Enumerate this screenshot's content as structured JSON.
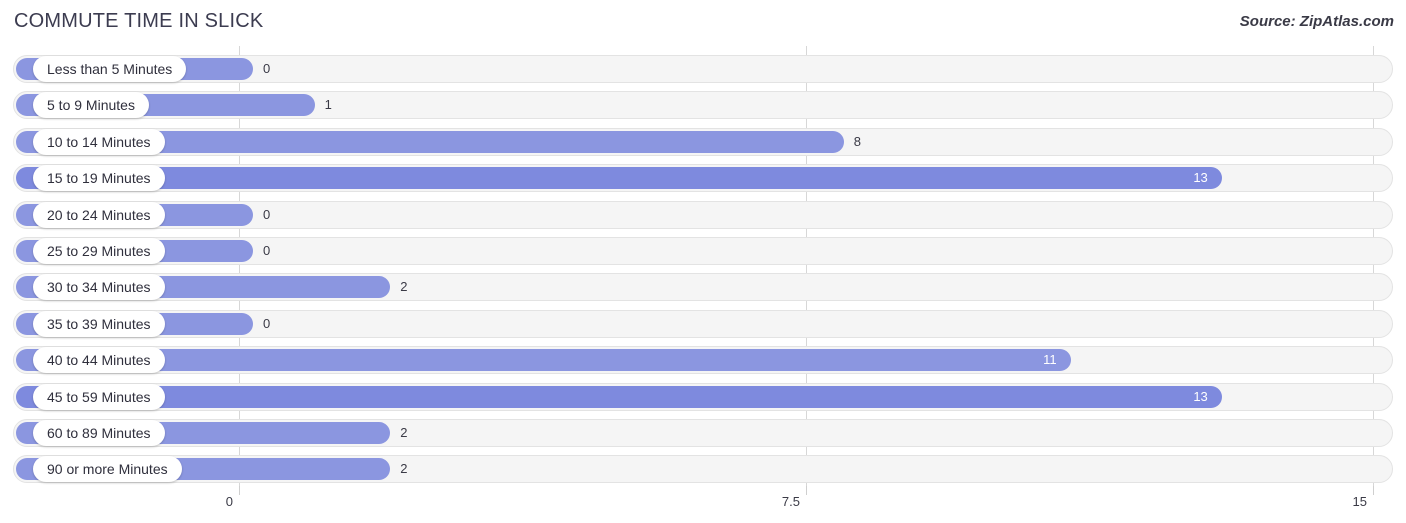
{
  "header": {
    "title": "COMMUTE TIME IN SLICK",
    "source": "Source: ZipAtlas.com"
  },
  "colors": {
    "bar": "#8b96e0",
    "bar_deep": "#7e8ade",
    "track": "#f5f5f5",
    "gridline": "#d7d7d7",
    "title_text": "#3c3c50",
    "value_text_inside": "#ffffff",
    "value_text_outside": "#3a3a46"
  },
  "chart_data": {
    "type": "bar",
    "orientation": "horizontal",
    "title": "COMMUTE TIME IN SLICK",
    "xlabel": "",
    "ylabel": "",
    "xlim": [
      0,
      15
    ],
    "grid": true,
    "legend": "none",
    "xticks": [
      "0",
      "7.5",
      "15"
    ],
    "xtick_values": [
      0,
      7.5,
      15
    ],
    "categories": [
      "Less than 5 Minutes",
      "5 to 9 Minutes",
      "10 to 14 Minutes",
      "15 to 19 Minutes",
      "20 to 24 Minutes",
      "25 to 29 Minutes",
      "30 to 34 Minutes",
      "35 to 39 Minutes",
      "40 to 44 Minutes",
      "45 to 59 Minutes",
      "60 to 89 Minutes",
      "90 or more Minutes"
    ],
    "values": [
      0,
      1,
      8,
      13,
      0,
      0,
      2,
      0,
      11,
      13,
      2,
      2
    ],
    "value_labels": [
      "0",
      "1",
      "8",
      "13",
      "0",
      "0",
      "2",
      "0",
      "11",
      "13",
      "2",
      "2"
    ]
  }
}
